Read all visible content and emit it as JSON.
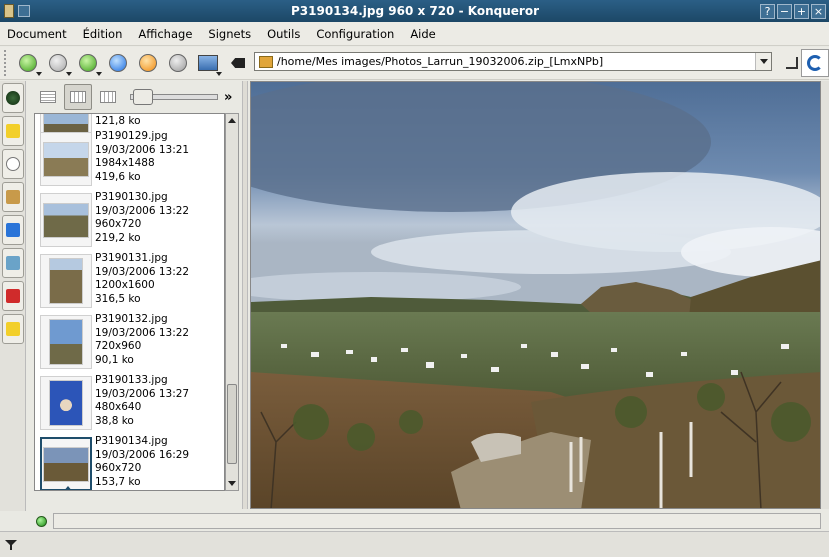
{
  "window": {
    "title": "P3190134.jpg 960 x 720 - Konqueror",
    "buttons": [
      "?",
      "−",
      "+",
      "×"
    ]
  },
  "menu": [
    "Document",
    "Édition",
    "Affichage",
    "Signets",
    "Outils",
    "Configuration",
    "Aide"
  ],
  "location": {
    "url": "/home/Mes images/Photos_Larrun_19032006.zip_[LmxNPb]"
  },
  "view_tools": {
    "more": "»"
  },
  "files": [
    {
      "name": "",
      "date": "",
      "dims": "",
      "size": "121,8 ko"
    },
    {
      "name": "P3190129.jpg",
      "date": "19/03/2006 13:21",
      "dims": "1984x1488",
      "size": "419,6 ko"
    },
    {
      "name": "P3190130.jpg",
      "date": "19/03/2006 13:22",
      "dims": "960x720",
      "size": "219,2 ko"
    },
    {
      "name": "P3190131.jpg",
      "date": "19/03/2006 13:22",
      "dims": "1200x1600",
      "size": "316,5 ko"
    },
    {
      "name": "P3190132.jpg",
      "date": "19/03/2006 13:22",
      "dims": "720x960",
      "size": "90,1 ko"
    },
    {
      "name": "P3190133.jpg",
      "date": "19/03/2006 13:27",
      "dims": "480x640",
      "size": "38,8 ko"
    },
    {
      "name": "P3190134.jpg",
      "date": "19/03/2006 16:29",
      "dims": "960x720",
      "size": "153,7 ko"
    }
  ],
  "colors": {
    "titlebar": "#1c4766",
    "selection": "#1e4d6b",
    "sky": "#5d7fa6",
    "hills": "#5a5a35"
  }
}
